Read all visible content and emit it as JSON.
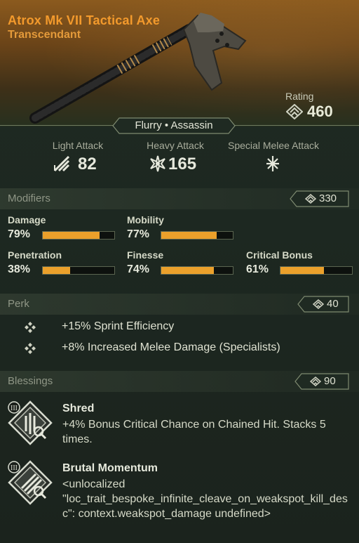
{
  "item": {
    "name": "Atrox Mk VII Tactical Axe",
    "rarity": "Transcendant",
    "rating_label": "Rating",
    "rating": "460",
    "class_tags": "Flurry • Assassin"
  },
  "attacks": [
    {
      "label": "Light Attack",
      "value": "82",
      "icon": "light-attack-icon"
    },
    {
      "label": "Heavy Attack",
      "value": "165",
      "icon": "heavy-attack-icon"
    },
    {
      "label": "Special Melee Attack",
      "value": "",
      "icon": "special-attack-icon"
    }
  ],
  "modifiers": {
    "title": "Modifiers",
    "score": "330",
    "stats": [
      {
        "label": "Damage",
        "value": "79%",
        "fraction": 0.79
      },
      {
        "label": "Mobility",
        "value": "77%",
        "fraction": 0.77
      },
      {
        "label": "Penetration",
        "value": "38%",
        "fraction": 0.38
      },
      {
        "label": "Finesse",
        "value": "74%",
        "fraction": 0.74
      },
      {
        "label": "Critical Bonus",
        "value": "61%",
        "fraction": 0.61
      }
    ]
  },
  "perks": {
    "title": "Perk",
    "score": "40",
    "items": [
      "+15% Sprint Efficiency",
      "+8% Increased Melee Damage (Specialists)"
    ]
  },
  "blessings": {
    "title": "Blessings",
    "score": "90",
    "items": [
      {
        "name": "Shred",
        "tier": "III",
        "desc": "+4% Bonus Critical Chance on Chained Hit. Stacks 5 times."
      },
      {
        "name": "Brutal Momentum",
        "tier": "III",
        "desc": "<unlocalized \"loc_trait_bespoke_infinite_cleave_on_weakspot_kill_desc\": context.weakspot_damage undefined>"
      }
    ]
  },
  "colors": {
    "accent": "#eba02b",
    "rarity": "#f39a2c"
  }
}
